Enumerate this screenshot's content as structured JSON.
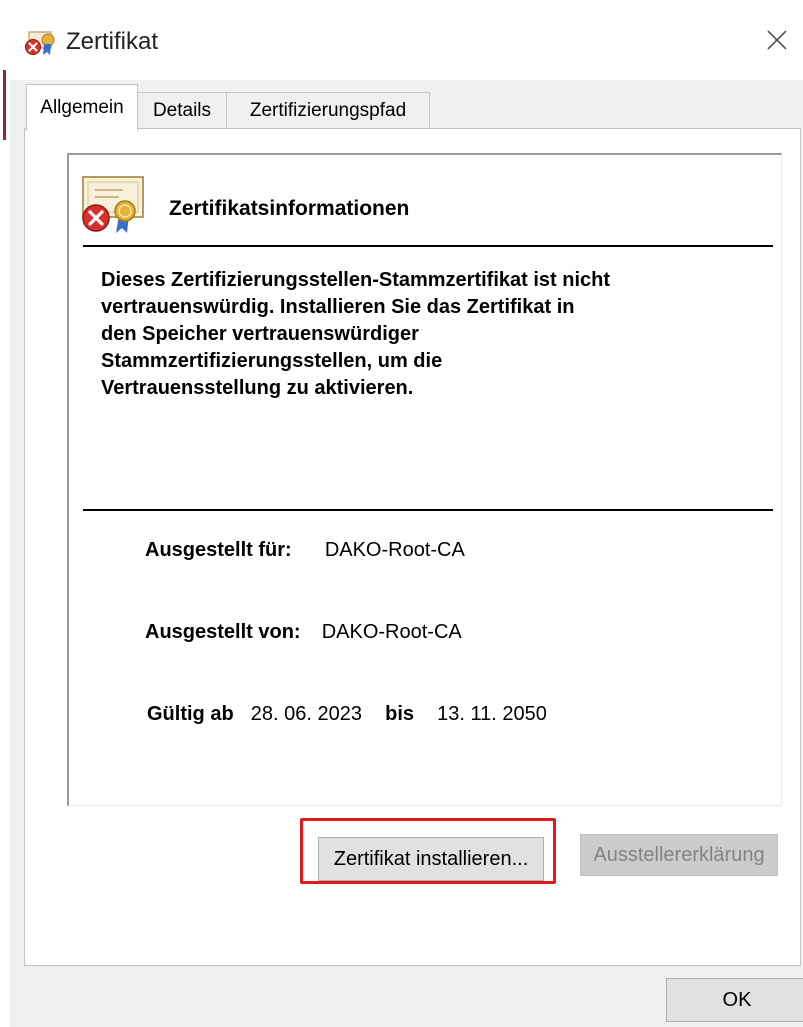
{
  "window": {
    "title": "Zertifikat",
    "close_icon": "close-icon"
  },
  "tabs": [
    {
      "label": "Allgemein",
      "active": true
    },
    {
      "label": "Details",
      "active": false
    },
    {
      "label": "Zertifizierungspfad",
      "active": false
    }
  ],
  "info": {
    "icon": "certificate-error-icon",
    "title": "Zertifikatsinformationen",
    "warning_lines": [
      "Dieses Zertifizierungsstellen-Stammzertifikat ist nicht",
      "vertrauenswürdig. Installieren Sie das Zertifikat in",
      "den Speicher vertrauenswürdiger",
      "Stammzertifizierungsstellen, um die",
      "Vertrauensstellung zu aktivieren."
    ],
    "issued_to_label": "Ausgestellt für:",
    "issued_to_value": "DAKO-Root-CA",
    "issued_by_label": "Ausgestellt von:",
    "issued_by_value": "DAKO-Root-CA",
    "valid_from_label": "Gültig ab",
    "valid_from_value": "28. 06. 2023",
    "valid_to_label": "bis",
    "valid_to_value": "13. 11. 2050"
  },
  "buttons": {
    "install": "Zertifikat installieren...",
    "issuer_statement": "Ausstellererklärung",
    "ok": "OK"
  },
  "colors": {
    "highlight": "#e01b1b",
    "error_red": "#d9302e",
    "seal_gold": "#e2b33a"
  }
}
